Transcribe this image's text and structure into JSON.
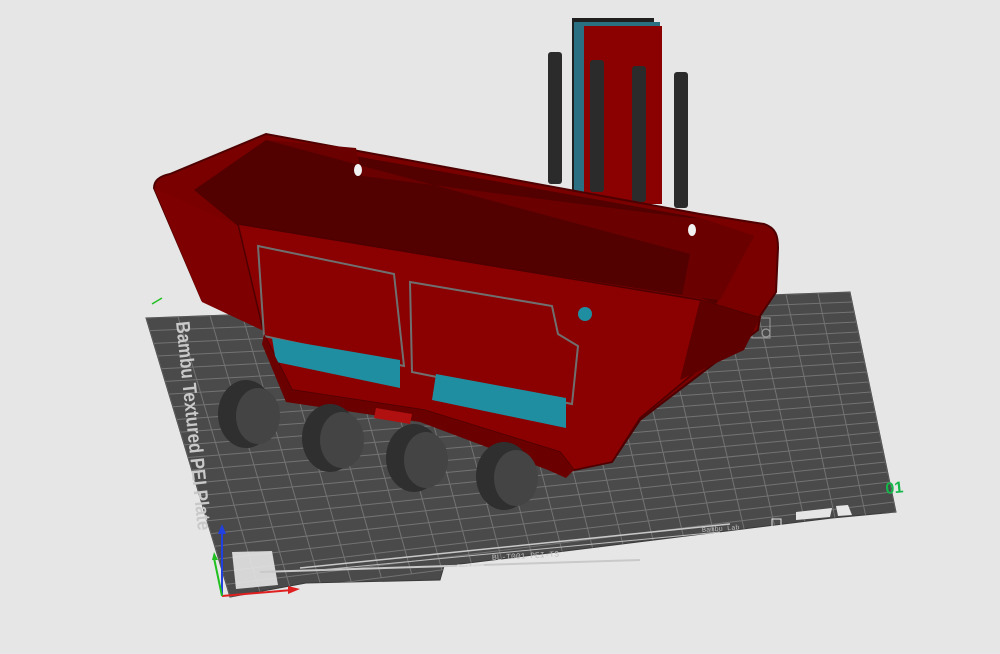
{
  "plate": {
    "name": "Bambu Textured PEI Plate",
    "number": "01",
    "bottom_strip_text": "BL-T001 PEI-TS",
    "right_strip_text": "Bambu Lab"
  },
  "colors": {
    "background": "#e6e6e6",
    "plate": "#4a4a4a",
    "grid": "#7a7a7a",
    "model_red": "#8b0000",
    "model_red_dark": "#5e0000",
    "model_teal": "#1f8ea0",
    "wheels": "#3a3a3a",
    "posts": "#2b2b2b",
    "plate_number": "#14b84a",
    "axis_x": "#e02020",
    "axis_y": "#20c020",
    "axis_z": "#2040e0"
  },
  "icons": {
    "axes": "xyz-axes-icon",
    "object_settings": "gear-icon"
  }
}
